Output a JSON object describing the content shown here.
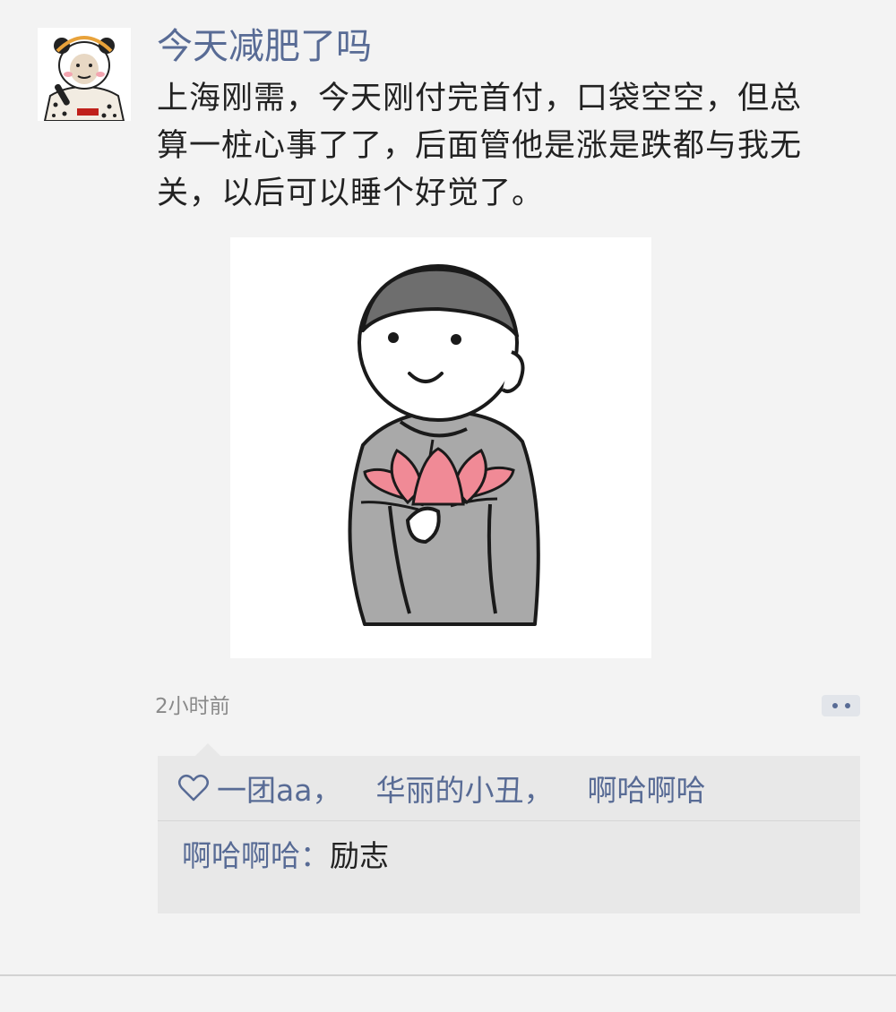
{
  "post": {
    "username": "今天减肥了吗",
    "text_lines": [
      "上海刚需，今天刚付完首付，口袋空空，但总",
      "算一桩心事了了，后面管他是涨是跌都与我无",
      "关，以后可以睡个好觉了。"
    ],
    "timestamp": "2小时前",
    "avatar_icon": "panda-meme-avatar",
    "image_icon": "monk-holding-lotus-illustration"
  },
  "likes": {
    "icon": "heart-outline-icon",
    "names": [
      "一团aa",
      "华丽的小丑",
      "啊哈啊哈"
    ],
    "separator": "，"
  },
  "comments": [
    {
      "author": "啊哈啊哈",
      "colon": "：",
      "text": "励志"
    }
  ],
  "colors": {
    "link": "#586b95",
    "text": "#222222",
    "timestamp": "#8a8a8a",
    "background": "#f3f3f3",
    "comment_bg": "#e8e8e8"
  }
}
